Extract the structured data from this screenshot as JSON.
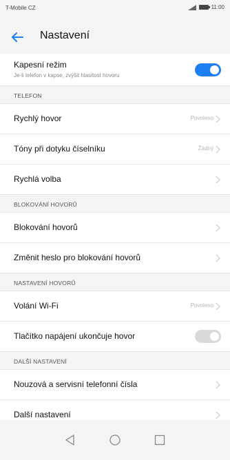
{
  "statusbar": {
    "carrier": "T-Mobile CZ",
    "time": "11:00"
  },
  "appbar": {
    "title": "Nastavení",
    "back_icon": "arrow-left-icon"
  },
  "pocket_mode": {
    "label": "Kapesní režim",
    "description": "Je-li telefon v kapse, zvýšit hlasitost hovoru",
    "enabled": true
  },
  "sections": {
    "telefon": "TELEFON",
    "blokovani": "BLOKOVÁNÍ HOVORŮ",
    "nastaveni": "NASTAVENÍ HOVORŮ",
    "dalsi": "DALŠÍ NASTAVENÍ"
  },
  "items": {
    "rychly_hovor": {
      "label": "Rychlý hovor",
      "value": "Povoleno"
    },
    "tony": {
      "label": "Tóny při dotyku číselníku",
      "value": "Žádný"
    },
    "rychla_volba": {
      "label": "Rychlá volba"
    },
    "blokovani_hovoru": {
      "label": "Blokování hovorů"
    },
    "zmenit_heslo": {
      "label": "Změnit heslo pro blokování hovorů"
    },
    "volani_wifi": {
      "label": "Volání Wi-Fi",
      "value": "Povoleno"
    },
    "tlacitko_napajeni": {
      "label": "Tlačítko napájení ukončuje hovor",
      "enabled": false
    },
    "nouzova": {
      "label": "Nouzová a servisní telefonní čísla"
    },
    "dalsi_nastaveni": {
      "label": "Další nastavení"
    }
  },
  "colors": {
    "accent": "#1e7ff2",
    "background": "#f4f4f4"
  }
}
